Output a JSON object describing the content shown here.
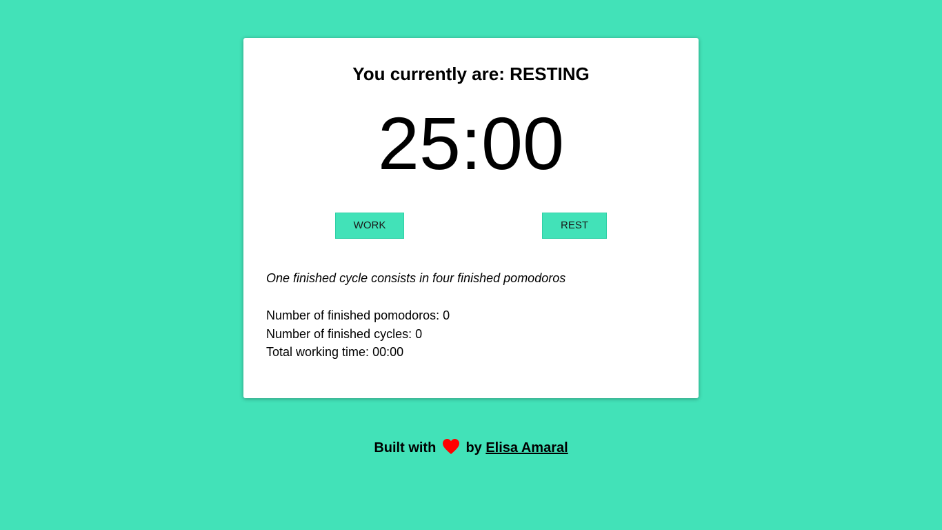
{
  "status": {
    "label": "You currently are:",
    "value": "RESTING"
  },
  "timer": {
    "display": "25:00"
  },
  "buttons": {
    "work_label": "WORK",
    "rest_label": "REST"
  },
  "info": {
    "cycle_note": "One finished cycle consists in four finished pomodoros"
  },
  "stats": {
    "pomodoros_label": "Number of finished pomodoros:",
    "pomodoros_value": "0",
    "cycles_label": "Number of finished cycles:",
    "cycles_value": "0",
    "working_time_label": "Total working time:",
    "working_time_value": "00:00"
  },
  "footer": {
    "built_with": "Built with",
    "by": "by",
    "author": "Elisa Amaral",
    "heart_icon": "heart-icon"
  },
  "colors": {
    "background": "#42e2b8",
    "card": "#ffffff",
    "button": "#42e2b8",
    "heart": "#ff0000"
  }
}
